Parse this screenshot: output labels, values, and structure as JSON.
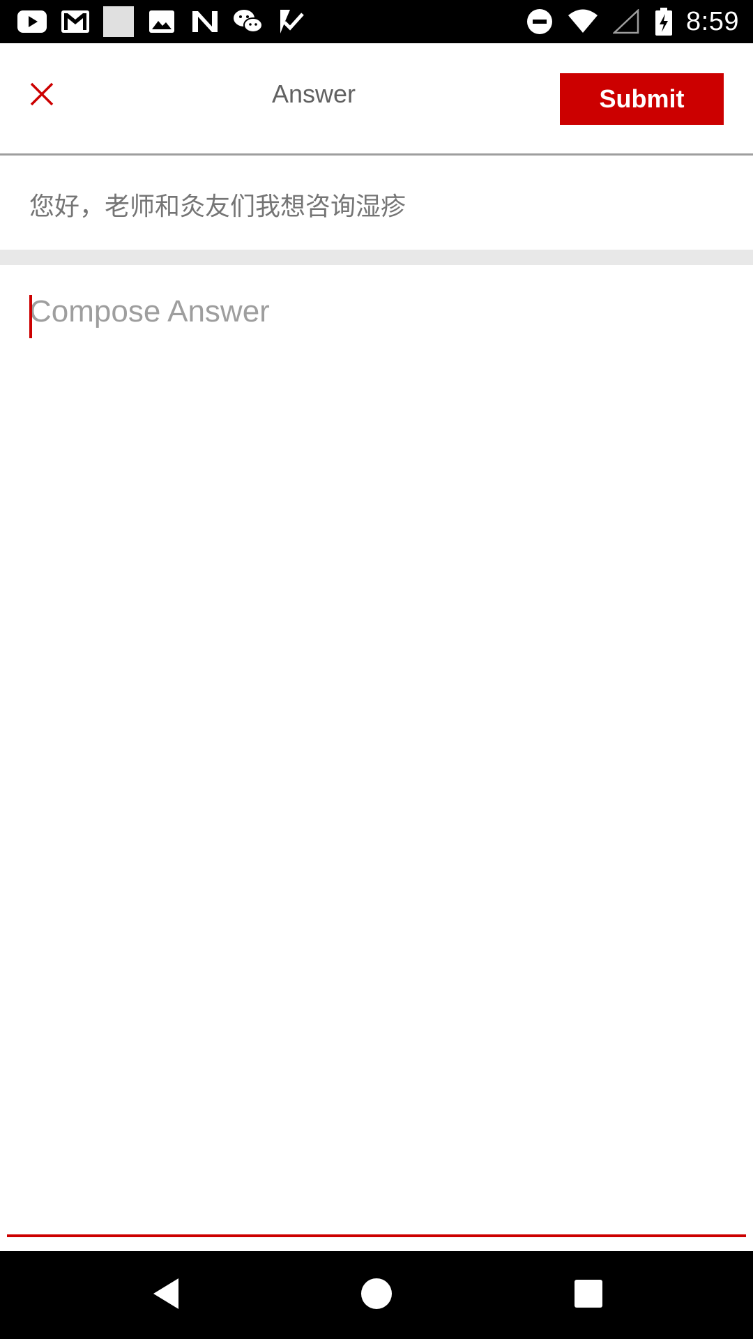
{
  "status_bar": {
    "time": "8:59",
    "left_icons": [
      "youtube-icon",
      "gmail-icon",
      "blank-notification-icon",
      "photo-icon",
      "n-app-icon",
      "wechat-icon",
      "task-check-icon"
    ],
    "right_icons": [
      "do-not-disturb-icon",
      "wifi-icon",
      "signal-icon",
      "battery-charging-icon"
    ]
  },
  "app_bar": {
    "close_icon": "close-icon",
    "title": "Answer",
    "submit_label": "Submit"
  },
  "question": {
    "text": "您好，老师和灸友们我想咨询湿疹"
  },
  "compose": {
    "placeholder": "Compose Answer",
    "value": ""
  },
  "nav_bar": {
    "icons": [
      "back-icon",
      "home-icon",
      "recents-icon"
    ]
  },
  "colors": {
    "accent": "#cc0000",
    "status_bar_bg": "#000000",
    "title_text": "#616161",
    "question_text": "#757575",
    "placeholder_text": "#9e9e9e",
    "divider_band": "#e8e8e8"
  }
}
